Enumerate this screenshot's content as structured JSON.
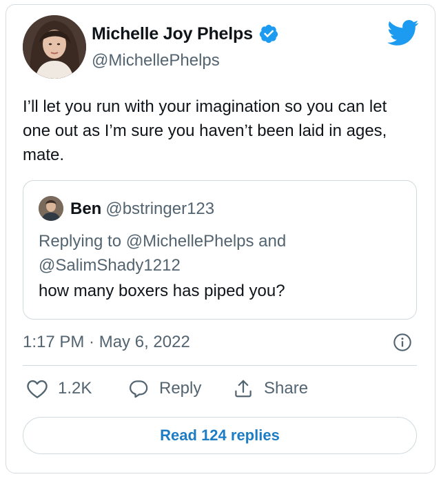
{
  "author": {
    "display_name": "Michelle Joy Phelps",
    "handle": "@MichellePhelps",
    "verified": true,
    "avatar_icon": "profile-photo"
  },
  "tweet": {
    "text": "I’ll let you run with your imagination so you can let one out as I’m sure you haven’t been laid in ages, mate.",
    "timestamp": "1:17 PM · May 6, 2022"
  },
  "quoted_tweet": {
    "display_name": "Ben",
    "handle": "@bstringer123",
    "replying_to": "Replying to @MichellePhelps and @SalimShady1212",
    "text": "how many boxers has piped you?"
  },
  "actions": {
    "like_count": "1.2K",
    "reply_label": "Reply",
    "share_label": "Share"
  },
  "read_replies_label": "Read 124 replies",
  "colors": {
    "accent": "#1d9bf0",
    "text_primary": "#0f1419",
    "text_secondary": "#536471",
    "border": "#cfd9de"
  }
}
